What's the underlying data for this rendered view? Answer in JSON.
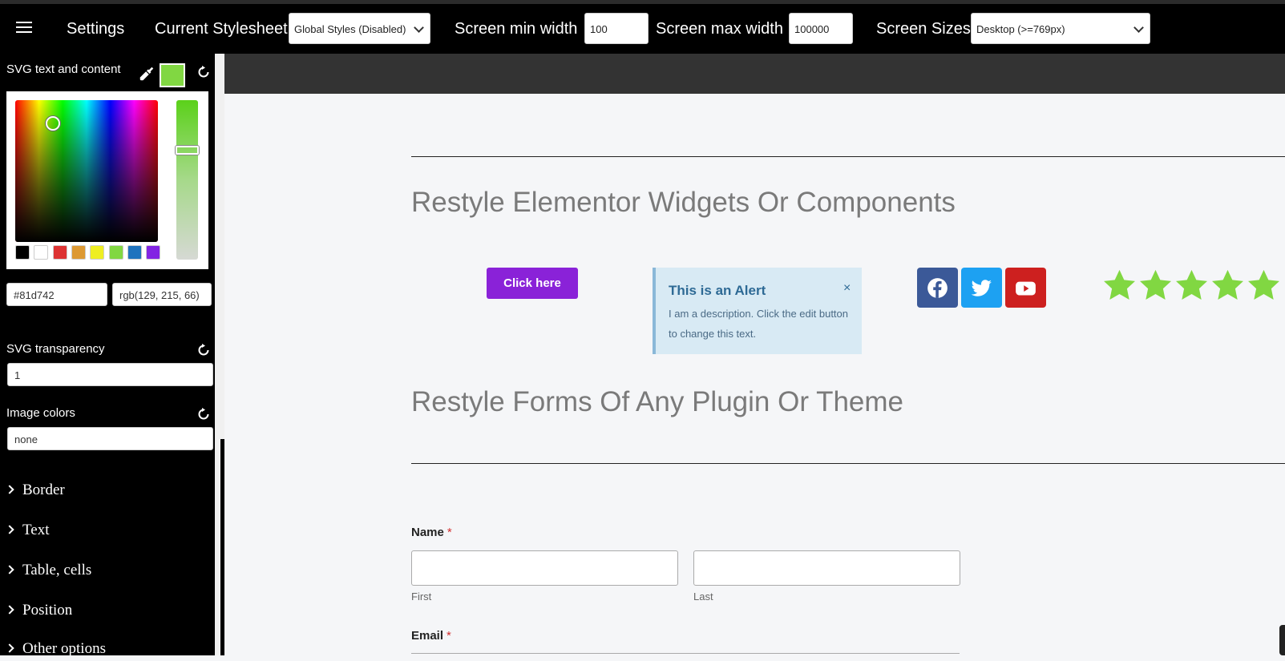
{
  "topbar": {
    "settings_label": "Settings",
    "stylesheet_label": "Current Stylesheet",
    "stylesheet_value": "Global Styles (Disabled)",
    "min_width_label": "Screen min width",
    "min_width_value": "100",
    "max_width_label": "Screen max width",
    "max_width_value": "100000",
    "screen_sizes_label": "Screen Sizes",
    "screen_sizes_value": "Desktop (>=769px)"
  },
  "sidebar": {
    "svg_text_label": "SVG text and content",
    "current_color": "#81d742",
    "hex_value": "#81d742",
    "rgb_value": "rgb(129, 215, 66)",
    "palette": [
      "#000000",
      "#ffffff",
      "#dd3333",
      "#dd9933",
      "#eeee22",
      "#81d742",
      "#1e73be",
      "#8224e3"
    ],
    "transparency_label": "SVG transparency",
    "transparency_value": "1",
    "image_colors_label": "Image colors",
    "image_colors_value": "none",
    "sections": [
      "Border",
      "Text",
      "Table, cells",
      "Position",
      "Other options"
    ]
  },
  "main": {
    "heading_widgets": "Restyle Elementor Widgets Or Components",
    "button_label": "Click here",
    "alert": {
      "title": "This is an Alert",
      "close": "×",
      "description": "I am a description. Click the edit button to change this text."
    },
    "social": [
      {
        "name": "facebook-icon",
        "color": "#3b5998"
      },
      {
        "name": "twitter-icon",
        "color": "#1da1f2"
      },
      {
        "name": "youtube-icon",
        "color": "#cd201f"
      }
    ],
    "rating": {
      "value": 5,
      "max": 5,
      "color": "#81d742"
    },
    "heading_forms": "Restyle Forms Of Any Plugin Or Theme",
    "form": {
      "name_label": "Name",
      "required_mark": "*",
      "first_sublabel": "First",
      "last_sublabel": "Last",
      "email_label": "Email"
    }
  }
}
